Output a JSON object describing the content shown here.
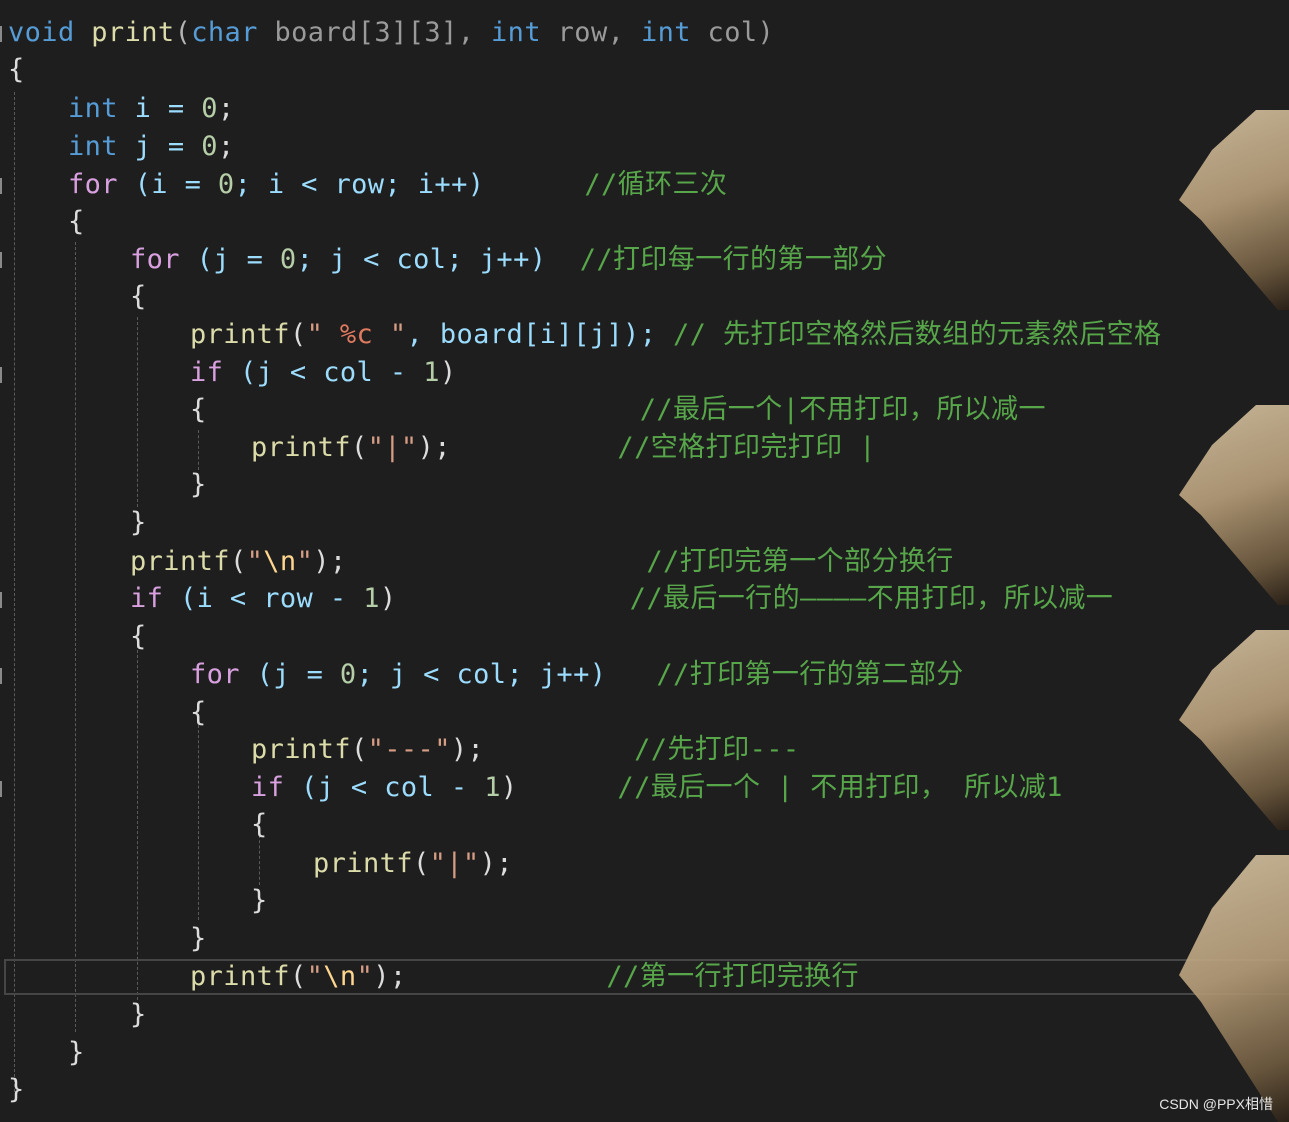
{
  "editor": {
    "lines": {
      "l1": {
        "a": "void",
        "b": " ",
        "c": "print",
        "d": "(",
        "e": "char",
        "f": " board[3][3], ",
        "g": "int",
        "h": " row, ",
        "i": "int",
        "j": " col)"
      },
      "l2": {
        "a": "{"
      },
      "l3": {
        "a": "int",
        "b": " i = ",
        "c": "0",
        "d": ";"
      },
      "l4": {
        "a": "int",
        "b": " j = ",
        "c": "0",
        "d": ";"
      },
      "l5": {
        "a": "for",
        "b": " (i = ",
        "c": "0",
        "d": "; i < row; i++)",
        "e": "      //循环三次"
      },
      "l6": {
        "a": "{"
      },
      "l7": {
        "a": "for",
        "b": " (j = ",
        "c": "0",
        "d": "; j < col; j++)",
        "e": "  //打印每一行的第一部分"
      },
      "l8": {
        "a": "{"
      },
      "l9": {
        "a": "printf",
        "b": "(",
        "c": "\" ",
        "d": "%c",
        "e": " \"",
        "f": ", board[i][j]); ",
        "g": "// 先打印空格然后数组的元素然后空格"
      },
      "l10": {
        "a": "if",
        "b": " (j < col - ",
        "c": "1",
        "d": ")"
      },
      "l11": {
        "a": "{",
        "b": "                          //最后一个|不用打印，所以减一"
      },
      "l12": {
        "a": "printf",
        "b": "(",
        "c": "\"|\"",
        "d": ");",
        "e": "          //空格打印完打印 |"
      },
      "l13": {
        "a": "}"
      },
      "l14": {
        "a": "}"
      },
      "l15": {
        "a": "printf",
        "b": "(",
        "c": "\"",
        "d": "\\n",
        "e": "\"",
        "f": ");",
        "g": "                  //打印完第一个部分换行"
      },
      "l16": {
        "a": "if",
        "b": " (i < row - ",
        "c": "1",
        "d": ")",
        "e": "              //最后一行的————不用打印，所以减一"
      },
      "l17": {
        "a": "{"
      },
      "l18": {
        "a": "for",
        "b": " (j = ",
        "c": "0",
        "d": "; j < col; j++)",
        "e": "   //打印第一行的第二部分"
      },
      "l19": {
        "a": "{"
      },
      "l20": {
        "a": "printf",
        "b": "(",
        "c": "\"---\"",
        "d": ");",
        "e": "         //先打印---"
      },
      "l21": {
        "a": "if",
        "b": " (j < col - ",
        "c": "1",
        "d": ")",
        "e": "      //最后一个 | 不用打印， 所以减1"
      },
      "l22": {
        "a": "{"
      },
      "l23": {
        "a": "printf",
        "b": "(",
        "c": "\"|\"",
        "d": ");"
      },
      "l24": {
        "a": "}"
      },
      "l25": {
        "a": "}"
      },
      "l26": {
        "a": "printf",
        "b": "(",
        "c": "\"",
        "d": "\\n",
        "e": "\"",
        "f": ");",
        "g": "            //第一行打印完换行"
      },
      "l27": {
        "a": "}"
      },
      "l28": {
        "a": "}"
      },
      "l29": {
        "a": "}"
      }
    }
  },
  "watermark": "CSDN @PPX相惜",
  "colors": {
    "background": "#1e1e1e",
    "keyword": "#569cd6",
    "control": "#d8a0df",
    "function": "#dcdcaa",
    "number": "#b5cea8",
    "string": "#d69d85",
    "comment": "#57a64a"
  }
}
